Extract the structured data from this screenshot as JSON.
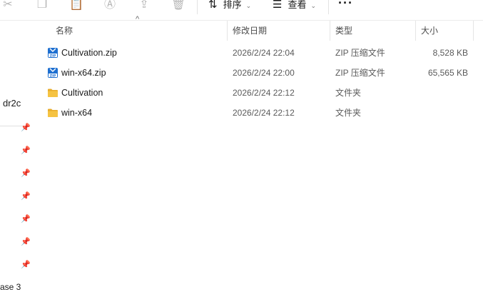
{
  "toolbar": {
    "sort_label": "排序",
    "view_label": "查看",
    "more_label": "···"
  },
  "nav": {
    "item_label": "dr2c",
    "bottom_label": "ase 3"
  },
  "columns": {
    "name": "名称",
    "date": "修改日期",
    "type": "类型",
    "size": "大小"
  },
  "files": [
    {
      "name": "Cultivation.zip",
      "date": "2026/2/24 22:04",
      "type": "ZIP 压缩文件",
      "size": "8,528 KB",
      "icon": "zip-icon"
    },
    {
      "name": "win-x64.zip",
      "date": "2026/2/24 22:00",
      "type": "ZIP 压缩文件",
      "size": "65,565 KB",
      "icon": "zip-icon"
    },
    {
      "name": "Cultivation",
      "date": "2026/2/24 22:12",
      "type": "文件夹",
      "size": "",
      "icon": "folder-icon"
    },
    {
      "name": "win-x64",
      "date": "2026/2/24 22:12",
      "type": "文件夹",
      "size": "",
      "icon": "folder-icon"
    }
  ],
  "colors": {
    "folder": "#f5c342",
    "zip_blue": "#1e6fd0"
  }
}
